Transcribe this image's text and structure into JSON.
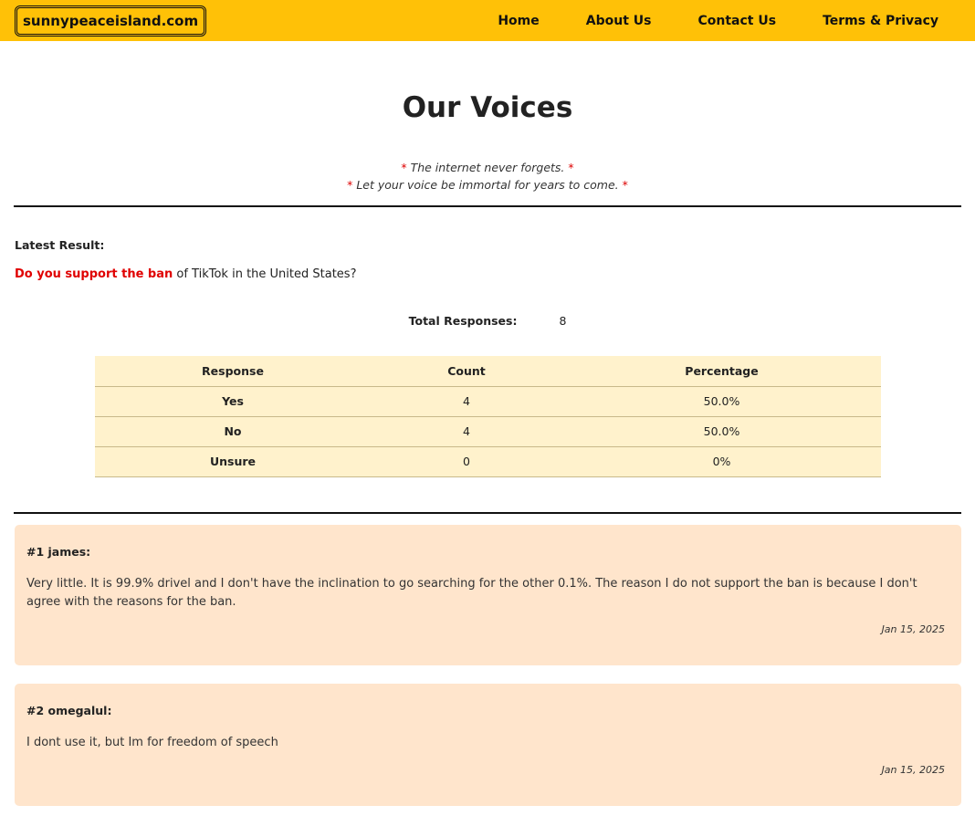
{
  "nav": {
    "logo": "sunnypeaceisland.com",
    "links": [
      "Home",
      "About Us",
      "Contact Us",
      "Terms & Privacy"
    ]
  },
  "header": {
    "title": "Our Voices",
    "tagline1": "The internet never forgets.",
    "tagline2": "Let your voice be immortal for years to come.",
    "star": "*"
  },
  "poll": {
    "latest_label": "Latest Result:",
    "question_strong": "Do you support the ban",
    "question_rest": " of TikTok in the United States?",
    "total_label": "Total Responses:",
    "total_value": "8",
    "columns": [
      "Response",
      "Count",
      "Percentage"
    ],
    "rows": [
      {
        "response": "Yes",
        "count": "4",
        "percentage": "50.0%"
      },
      {
        "response": "No",
        "count": "4",
        "percentage": "50.0%"
      },
      {
        "response": "Unsure",
        "count": "0",
        "percentage": "0%"
      }
    ]
  },
  "comments": [
    {
      "header": "#1 james:",
      "body": "Very little. It is 99.9% drivel and I don't have the inclination to go searching for the other 0.1%. The reason I do not support the ban is because I don't agree with the reasons for the ban.",
      "date": "Jan 15, 2025"
    },
    {
      "header": "#2 omegalul:",
      "body": "I dont use it, but Im for freedom of speech",
      "date": "Jan 15, 2025"
    }
  ],
  "colors": {
    "navbar": "#ffc107",
    "accent_red": "#e00000",
    "table_bg": "#fff2cc",
    "comment_bg": "#ffe5cc"
  }
}
